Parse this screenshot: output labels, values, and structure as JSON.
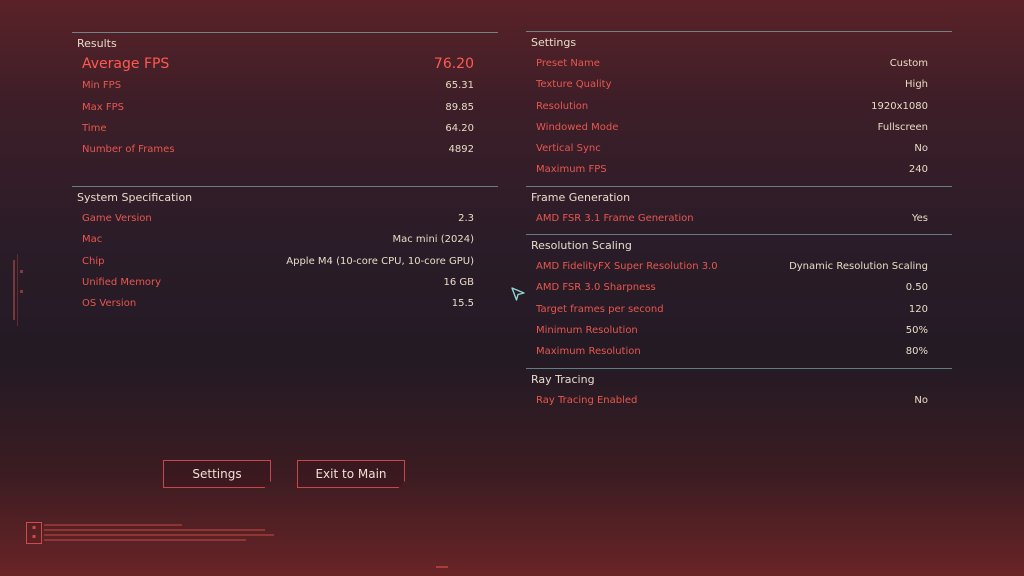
{
  "results": {
    "header": "Results",
    "rows": [
      {
        "label": "Average FPS",
        "value": "76.20"
      },
      {
        "label": "Min FPS",
        "value": "65.31"
      },
      {
        "label": "Max FPS",
        "value": "89.85"
      },
      {
        "label": "Time",
        "value": "64.20"
      },
      {
        "label": "Number of Frames",
        "value": "4892"
      }
    ]
  },
  "system": {
    "header": "System Specification",
    "rows": [
      {
        "label": "Game Version",
        "value": "2.3"
      },
      {
        "label": "Mac",
        "value": "Mac mini (2024)"
      },
      {
        "label": "Chip",
        "value": "Apple M4 (10-core CPU, 10-core GPU)"
      },
      {
        "label": "Unified Memory",
        "value": "16 GB"
      },
      {
        "label": "OS Version",
        "value": "15.5"
      }
    ]
  },
  "settings": {
    "header": "Settings",
    "rows": [
      {
        "label": "Preset Name",
        "value": "Custom"
      },
      {
        "label": "Texture Quality",
        "value": "High"
      },
      {
        "label": "Resolution",
        "value": "1920x1080"
      },
      {
        "label": "Windowed Mode",
        "value": "Fullscreen"
      },
      {
        "label": "Vertical Sync",
        "value": "No"
      },
      {
        "label": "Maximum FPS",
        "value": "240"
      }
    ]
  },
  "frame_generation": {
    "header": "Frame Generation",
    "rows": [
      {
        "label": "AMD FSR 3.1 Frame Generation",
        "value": "Yes"
      }
    ]
  },
  "resolution_scaling": {
    "header": "Resolution Scaling",
    "rows": [
      {
        "label": "AMD FidelityFX Super Resolution 3.0",
        "value": "Dynamic Resolution Scaling"
      },
      {
        "label": "AMD FSR 3.0 Sharpness",
        "value": "0.50"
      },
      {
        "label": "Target frames per second",
        "value": "120"
      },
      {
        "label": "Minimum Resolution",
        "value": "50%"
      },
      {
        "label": "Maximum Resolution",
        "value": "80%"
      }
    ]
  },
  "ray_tracing": {
    "header": "Ray Tracing",
    "rows": [
      {
        "label": "Ray Tracing Enabled",
        "value": "No"
      }
    ]
  },
  "buttons": {
    "settings": "Settings",
    "exit": "Exit to Main Menu"
  },
  "icons": {
    "cursor": "cursor-arrow-icon",
    "logo": "game-logo-icon"
  },
  "colors": {
    "label_red": "#e8574f",
    "accent_cyan": "#8cd2d2",
    "button_border": "#c9474a"
  }
}
